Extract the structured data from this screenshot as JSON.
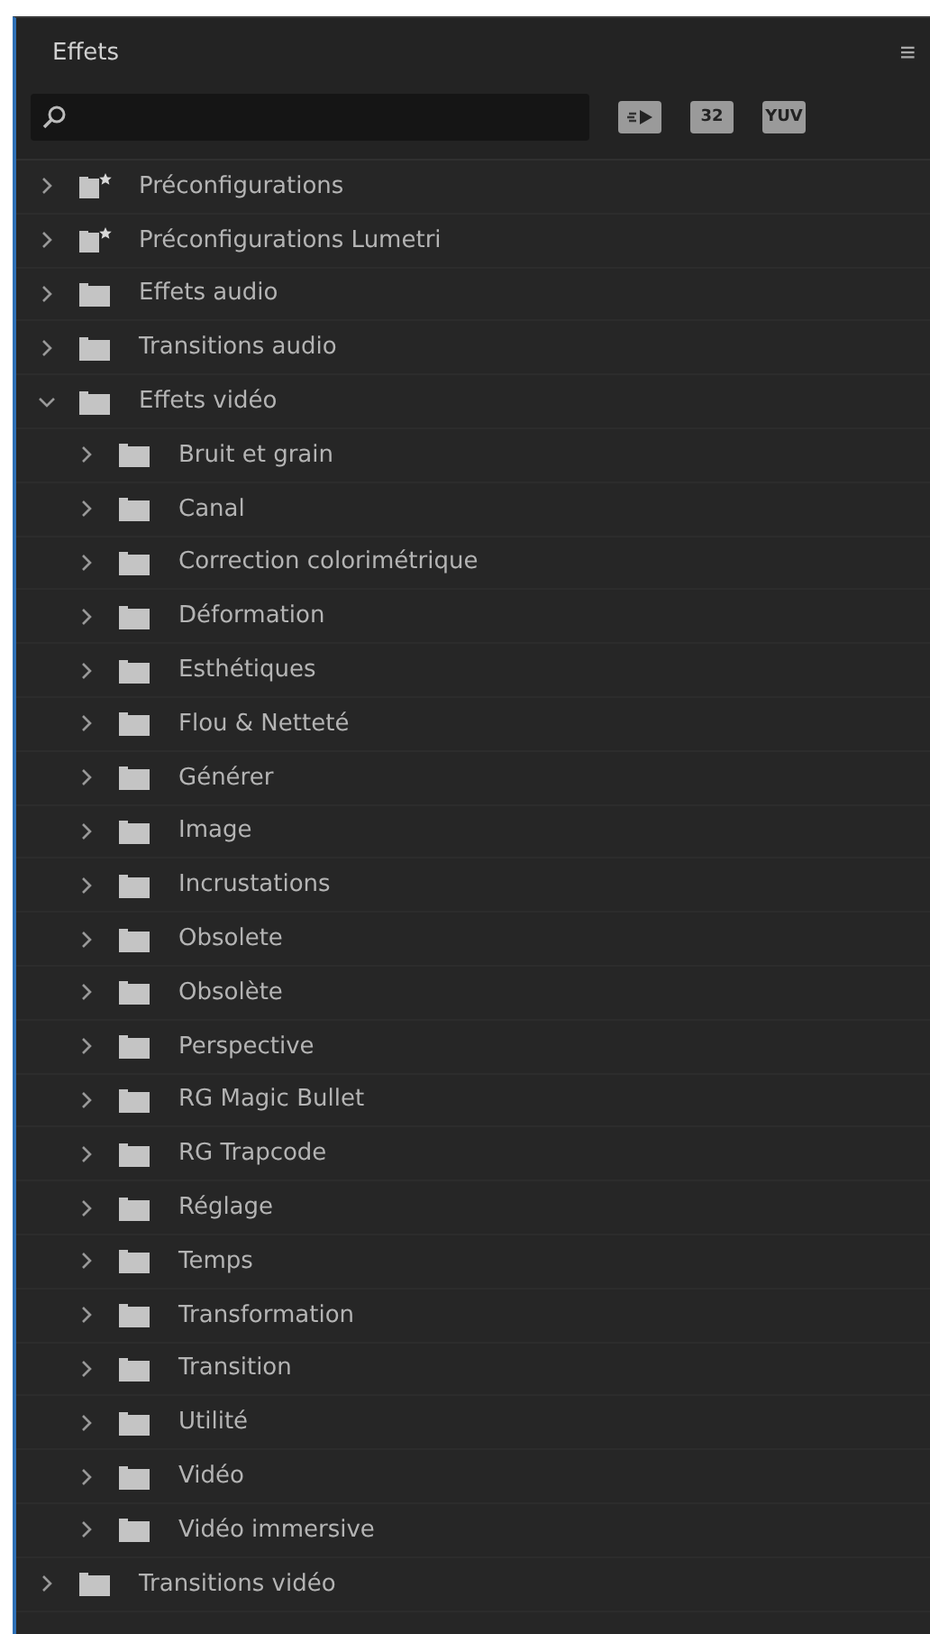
{
  "panel": {
    "title": "Effets",
    "menu": "≡"
  },
  "filter_buttons": [
    {
      "kind": "accelerated"
    },
    {
      "label": "32",
      "kind": "text"
    },
    {
      "label": "YUV",
      "kind": "text"
    }
  ],
  "tree": [
    {
      "label": "Préconfigurations",
      "kind": "preset",
      "expanded": false
    },
    {
      "label": "Préconfigurations Lumetri",
      "kind": "preset",
      "expanded": false
    },
    {
      "label": "Effets audio",
      "kind": "folder",
      "expanded": false
    },
    {
      "label": "Transitions audio",
      "kind": "folder",
      "expanded": false
    },
    {
      "label": "Effets vidéo",
      "kind": "folder",
      "expanded": true,
      "children": [
        {
          "label": "Bruit et grain",
          "kind": "folder",
          "expanded": false
        },
        {
          "label": "Canal",
          "kind": "folder",
          "expanded": false
        },
        {
          "label": "Correction colorimétrique",
          "kind": "folder",
          "expanded": false
        },
        {
          "label": "Déformation",
          "kind": "folder",
          "expanded": false
        },
        {
          "label": "Esthétiques",
          "kind": "folder",
          "expanded": false
        },
        {
          "label": "Flou & Netteté",
          "kind": "folder",
          "expanded": false
        },
        {
          "label": "Générer",
          "kind": "folder",
          "expanded": false
        },
        {
          "label": "Image",
          "kind": "folder",
          "expanded": false
        },
        {
          "label": "Incrustations",
          "kind": "folder",
          "expanded": false
        },
        {
          "label": "Obsolete",
          "kind": "folder",
          "expanded": false
        },
        {
          "label": "Obsolète",
          "kind": "folder",
          "expanded": false
        },
        {
          "label": "Perspective",
          "kind": "folder",
          "expanded": false
        },
        {
          "label": "RG Magic Bullet",
          "kind": "folder",
          "expanded": false
        },
        {
          "label": "RG Trapcode",
          "kind": "folder",
          "expanded": false
        },
        {
          "label": "Réglage",
          "kind": "folder",
          "expanded": false
        },
        {
          "label": "Temps",
          "kind": "folder",
          "expanded": false
        },
        {
          "label": "Transformation",
          "kind": "folder",
          "expanded": false
        },
        {
          "label": "Transition",
          "kind": "folder",
          "expanded": false
        },
        {
          "label": "Utilité",
          "kind": "folder",
          "expanded": false
        },
        {
          "label": "Vidéo",
          "kind": "folder",
          "expanded": false
        },
        {
          "label": "Vidéo immersive",
          "kind": "folder",
          "expanded": false
        }
      ]
    },
    {
      "label": "Transitions vidéo",
      "kind": "folder",
      "expanded": false
    }
  ]
}
